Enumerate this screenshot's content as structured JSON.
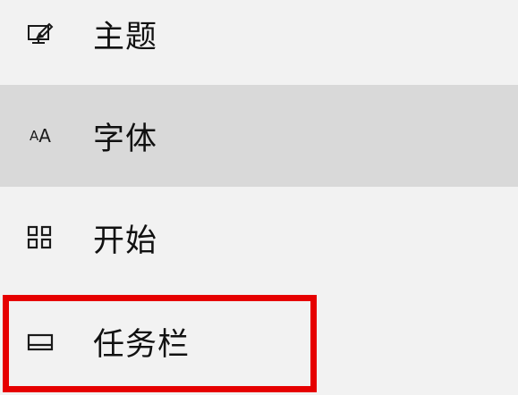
{
  "menu": {
    "items": [
      {
        "label": "主题",
        "icon": "theme-icon",
        "selected": false
      },
      {
        "label": "字体",
        "icon": "fonts-icon",
        "selected": true
      },
      {
        "label": "开始",
        "icon": "start-icon",
        "selected": false
      },
      {
        "label": "任务栏",
        "icon": "taskbar-icon",
        "selected": false,
        "highlighted": true
      }
    ],
    "fonts_icon_glyph_small": "A",
    "fonts_icon_glyph_large": "A"
  },
  "colors": {
    "background": "#f2f2f2",
    "selected_background": "#d9d9d9",
    "highlight_border": "#e60000",
    "text": "#111111"
  }
}
